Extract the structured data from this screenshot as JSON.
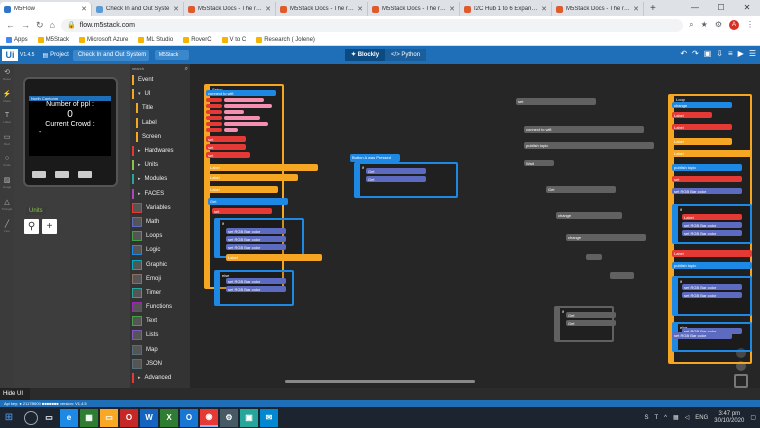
{
  "browser": {
    "tabs": [
      {
        "title": "M5Flow",
        "active": true,
        "color": "#2f76c9"
      },
      {
        "title": "Check In and Out Syste",
        "active": false,
        "color": "#5b9bd5"
      },
      {
        "title": "M5Stack Docs - The refe",
        "active": false,
        "color": "#e05a2a"
      },
      {
        "title": "M5Stack Docs - The refe",
        "active": false,
        "color": "#e05a2a"
      },
      {
        "title": "M5Stack Docs - The refe",
        "active": false,
        "color": "#e05a2a"
      },
      {
        "title": "I2C Hub 1 to 6 Expansio",
        "active": false,
        "color": "#e05a2a"
      },
      {
        "title": "M5Stack Docs - The refe",
        "active": false,
        "color": "#e05a2a"
      }
    ],
    "url": "flow.m5stack.com",
    "profile_initial": "A",
    "bookmarks": [
      "Apps",
      "M5Stack",
      "Microsoft Azure",
      "ML Studio",
      "RoverC",
      "V to C",
      "Research ( Jolene)"
    ]
  },
  "app": {
    "logo": "Ui",
    "version": "V1.4.5",
    "project_label": "Project",
    "project_name": "Check In and Out System",
    "device": "M5Stack",
    "mode_blockly": "Blockly",
    "mode_python": "Python",
    "rail_labels": [
      "Reset",
      "Flash",
      "Label",
      "Rect",
      "Circle",
      "Image",
      "Triangle",
      "Line"
    ],
    "screen_bar_text": "North Cantonm",
    "screen_lines": [
      "Number of ppl :",
      "0",
      "Current Crowd :",
      "-"
    ],
    "units_label": "Units",
    "search_label": "search",
    "categories": [
      {
        "label": "Event",
        "color": "#f5a623",
        "sub": false
      },
      {
        "label": "UI",
        "color": "#f5a623",
        "sub": false,
        "arrow": "▾"
      },
      {
        "label": "Title",
        "color": "#f5a623",
        "sub": true
      },
      {
        "label": "Label",
        "color": "#f5a623",
        "sub": true
      },
      {
        "label": "Screen",
        "color": "#f5a623",
        "sub": true
      },
      {
        "label": "Hardwares",
        "color": "#e53935",
        "sub": false,
        "arrow": "▸"
      },
      {
        "label": "Units",
        "color": "#8bc34a",
        "sub": false,
        "arrow": "▸"
      },
      {
        "label": "Modules",
        "color": "#26a69a",
        "sub": false,
        "arrow": "▸"
      },
      {
        "label": "FACES",
        "color": "#ab47bc",
        "sub": false,
        "arrow": "▸"
      },
      {
        "label": "Variables",
        "color": "#e53935",
        "sub": false
      },
      {
        "label": "Math",
        "color": "#5c6bc0",
        "sub": false
      },
      {
        "label": "Loops",
        "color": "#43a047",
        "sub": false
      },
      {
        "label": "Logic",
        "color": "#1e88e5",
        "sub": false
      },
      {
        "label": "Graphic",
        "color": "#00acc1",
        "sub": false
      },
      {
        "label": "Emoji",
        "color": "#8d6e63",
        "sub": false
      },
      {
        "label": "Timer",
        "color": "#26a69a",
        "sub": false
      },
      {
        "label": "Functions",
        "color": "#9c27b0",
        "sub": false
      },
      {
        "label": "Text",
        "color": "#43a047",
        "sub": false
      },
      {
        "label": "Lists",
        "color": "#7e57c2",
        "sub": false
      },
      {
        "label": "Map",
        "color": "#546e7a",
        "sub": false
      },
      {
        "label": "JSON",
        "color": "#546e7a",
        "sub": false
      },
      {
        "label": "Advanced",
        "color": "#e53935",
        "sub": false,
        "arrow": "▸"
      }
    ],
    "hide_ui": "Hide UI",
    "status_text": "Api key: ● 2117B600   ■■■■■■■   version: V1.4.5"
  },
  "blocks_text": {
    "setup": "Setup",
    "wifi": "connect to wifi",
    "connect_all": "Connect to all",
    "publish": "publish topic",
    "wait": "Wait",
    "change": "change",
    "label": "Label",
    "show": "show",
    "set": "set",
    "to": "to",
    "get": "Get",
    "status": "status",
    "loop": "Loop",
    "if": "if",
    "do": "do",
    "else": "else",
    "rgb": "set RGB Bar color",
    "btn": "Button A was Pressed"
  },
  "taskbar": {
    "time": "3:47 pm",
    "date": "30/10/2020",
    "lang": "ENG"
  }
}
